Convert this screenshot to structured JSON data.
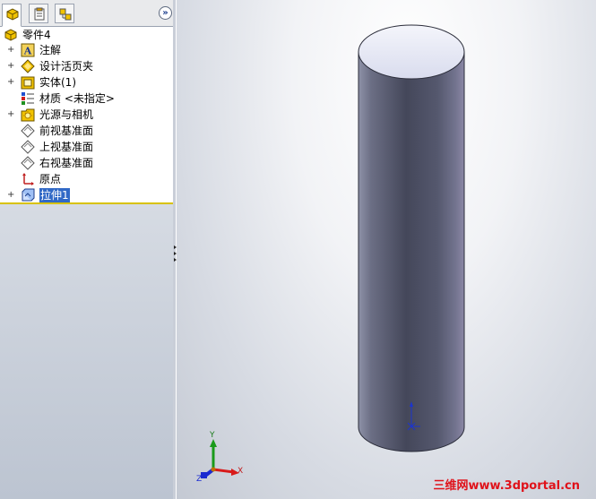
{
  "tree": {
    "root": {
      "label": "零件4",
      "icon": "part-icon"
    },
    "items": [
      {
        "label": "注解",
        "icon": "annotations-icon",
        "expandable": true
      },
      {
        "label": "设计活页夹",
        "icon": "design-binder-icon",
        "expandable": true
      },
      {
        "label": "实体(1)",
        "icon": "solid-bodies-icon",
        "expandable": true
      },
      {
        "label": "材质 <未指定>",
        "icon": "material-icon",
        "expandable": false
      },
      {
        "label": "光源与相机",
        "icon": "lights-cameras-icon",
        "expandable": true
      },
      {
        "label": "前视基准面",
        "icon": "plane-icon",
        "expandable": false
      },
      {
        "label": "上视基准面",
        "icon": "plane-icon",
        "expandable": false
      },
      {
        "label": "右视基准面",
        "icon": "plane-icon",
        "expandable": false
      },
      {
        "label": "原点",
        "icon": "origin-icon",
        "expandable": false
      },
      {
        "label": "拉伸1",
        "icon": "extrude-icon",
        "expandable": true,
        "selected": true
      }
    ]
  },
  "tabs": [
    "feature-manager-tab",
    "property-manager-tab",
    "configuration-manager-tab"
  ],
  "triad": {
    "x": "X",
    "y": "Y",
    "z": "Z"
  },
  "watermark": "三维网www.3dportal.cn",
  "colors": {
    "selection": "#3169c6",
    "rollback_bar": "#d8c200",
    "cylinder_top": "#e8eaf6",
    "cylinder_side_dark": "#4a4e60"
  }
}
